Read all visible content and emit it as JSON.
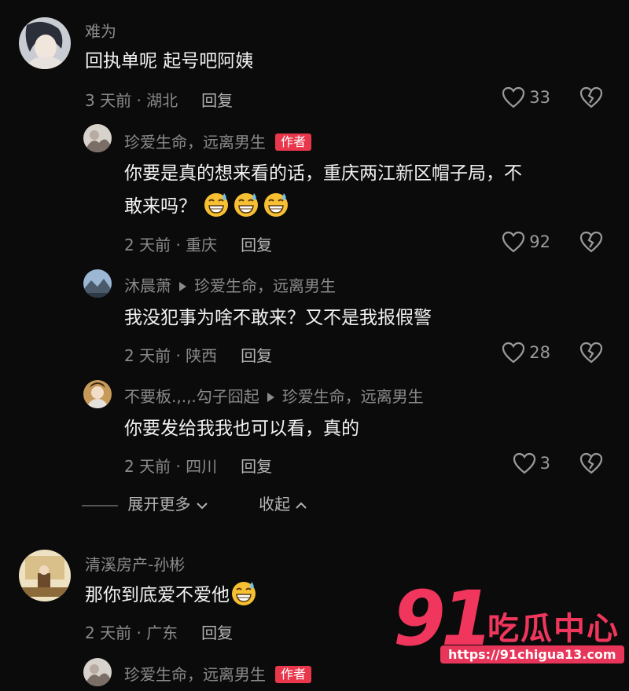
{
  "comments": [
    {
      "username": "难为",
      "text": "回执单呢  起号吧阿姨",
      "time": "3 天前",
      "location": "湖北",
      "reply_label": "回复",
      "likes": "33"
    },
    {
      "username": "珍爱生命，远离男生",
      "author_badge": "作者",
      "text_line1": "你要是真的想来看的话，重庆两江新区帽子局，不",
      "text_line2": "敢来吗？",
      "emoji": "grinning-sweat-emoji",
      "time": "2 天前",
      "location": "重庆",
      "reply_label": "回复",
      "likes": "92"
    },
    {
      "username": "沐晨萧",
      "reply_to": "珍爱生命，远离男生",
      "text": "我没犯事为啥不敢来？又不是我报假警",
      "time": "2 天前",
      "location": "陕西",
      "reply_label": "回复",
      "likes": "28"
    },
    {
      "username": "不要板.,.,.勾子囧起",
      "reply_to": "珍爱生命，远离男生",
      "text": "你要发给我我也可以看，真的",
      "time": "2 天前",
      "location": "四川",
      "reply_label": "回复",
      "likes": "3"
    },
    {
      "username": "清溪房产-孙彬",
      "text": "那你到底爱不爱他",
      "time": "2 天前",
      "location": "广东",
      "reply_label": "回复"
    },
    {
      "username": "珍爱生命，远离男生",
      "author_badge": "作者"
    }
  ],
  "controls": {
    "expand_more": "展开更多",
    "collapse": "收起"
  },
  "watermark": {
    "logo_number": "91",
    "logo_text": "吃瓜中心",
    "url": "https://91chigua13.com"
  },
  "colors": {
    "background": "#0b0b0b",
    "author_badge": "#e8364b",
    "watermark": "#f0365c"
  }
}
